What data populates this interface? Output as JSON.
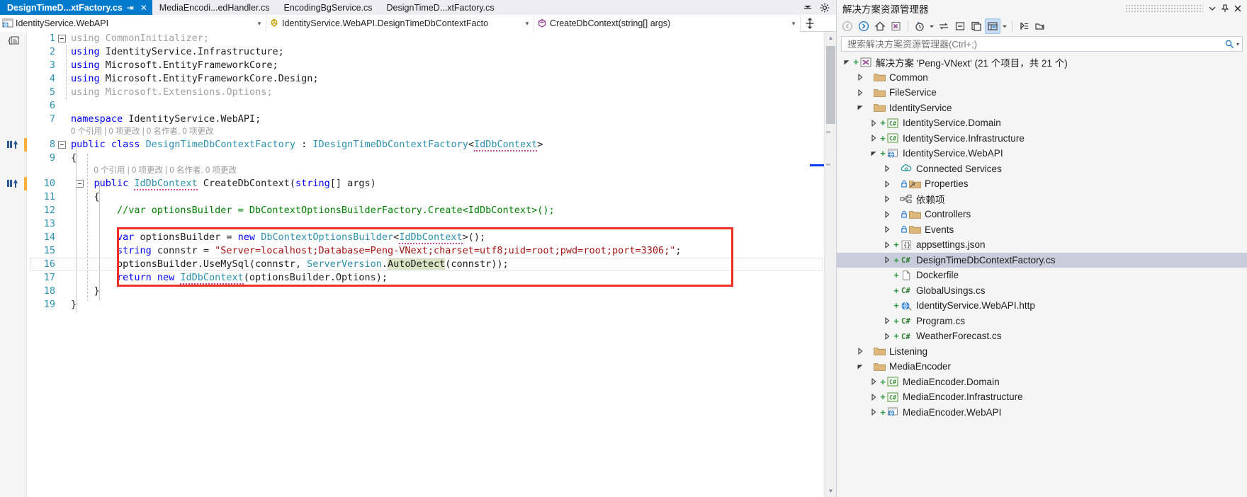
{
  "window": {
    "app": "Visual Studio",
    "accent_color": "#007acc",
    "highlight_box_color": "#ee3124"
  },
  "tabs": {
    "items": [
      {
        "label": "DesignTimeD...xtFactory.cs",
        "active": true,
        "pin_icon": "pin-icon",
        "close_icon": "close-icon"
      },
      {
        "label": "MediaEncodi...edHandler.cs",
        "active": false
      },
      {
        "label": "EncodingBgService.cs",
        "active": false
      },
      {
        "label": "DesignTimeD...xtFactory.cs",
        "active": false
      }
    ],
    "overflow_icon": "chevron-down-icon",
    "settings_icon": "gear-icon"
  },
  "navbar": {
    "project": {
      "text": "IdentityService.WebAPI",
      "icon": "web-project-icon",
      "arrow": "chevron-down-icon"
    },
    "type": {
      "text": "IdentityService.WebAPI.DesignTimeDbContextFacto",
      "icon": "class-icon",
      "arrow": "chevron-down-icon"
    },
    "member": {
      "text": "CreateDbContext(string[] args)",
      "icon": "method-icon",
      "arrow": "chevron-down-icon"
    },
    "split_icon": "split-window-icon"
  },
  "editor": {
    "lines": [
      {
        "num": "1",
        "indent": 0,
        "tokens": [
          {
            "t": "using CommonInitializer;",
            "c": "gray"
          }
        ],
        "collapse": true,
        "changed": false
      },
      {
        "num": "2",
        "indent": 0,
        "tokens": [
          {
            "t": "using",
            "c": "k"
          },
          {
            "t": " IdentityService.Infrastructure;",
            "c": "p"
          }
        ],
        "changed": false
      },
      {
        "num": "3",
        "indent": 0,
        "tokens": [
          {
            "t": "using",
            "c": "k"
          },
          {
            "t": " Microsoft.EntityFrameworkCore;",
            "c": "p"
          }
        ],
        "changed": false
      },
      {
        "num": "4",
        "indent": 0,
        "tokens": [
          {
            "t": "using",
            "c": "k"
          },
          {
            "t": " Microsoft.EntityFrameworkCore.Design;",
            "c": "p"
          }
        ],
        "changed": false
      },
      {
        "num": "5",
        "indent": 0,
        "tokens": [
          {
            "t": "using Microsoft.Extensions.Options;",
            "c": "gray"
          }
        ],
        "changed": false
      },
      {
        "num": "6",
        "indent": 0,
        "tokens": [
          {
            "t": "",
            "c": "p"
          }
        ],
        "changed": false
      },
      {
        "num": "7",
        "indent": 0,
        "tokens": [
          {
            "t": "namespace",
            "c": "k"
          },
          {
            "t": " IdentityService.WebAPI;",
            "c": "p"
          }
        ],
        "changed": false
      },
      {
        "num": "8",
        "indent": 0,
        "collapse": true,
        "changed": true,
        "tokens": [
          {
            "t": "public class ",
            "c": "k"
          },
          {
            "t": "DesignTimeDbContextFactory",
            "c": "t"
          },
          {
            "t": " : ",
            "c": "p"
          },
          {
            "t": "IDesignTimeDbContextFactory",
            "c": "t"
          },
          {
            "t": "<",
            "c": "p"
          },
          {
            "t": "IdDbContext",
            "c": "t und"
          },
          {
            "t": ">",
            "c": "p"
          }
        ]
      },
      {
        "num": "9",
        "indent": 0,
        "tokens": [
          {
            "t": "{",
            "c": "p"
          }
        ],
        "changed": false
      },
      {
        "num": "10",
        "indent": 1,
        "collapse": true,
        "changed": true,
        "tokens": [
          {
            "t": "public ",
            "c": "k"
          },
          {
            "t": "IdDbContext",
            "c": "t und"
          },
          {
            "t": " CreateDbContext(",
            "c": "p"
          },
          {
            "t": "string",
            "c": "k"
          },
          {
            "t": "[] args)",
            "c": "p"
          }
        ]
      },
      {
        "num": "11",
        "indent": 1,
        "tokens": [
          {
            "t": "{",
            "c": "p"
          }
        ],
        "changed": false
      },
      {
        "num": "12",
        "indent": 2,
        "tokens": [
          {
            "t": "//var optionsBuilder = DbContextOptionsBuilderFactory.Create<IdDbContext>();",
            "c": "c"
          }
        ],
        "changed": false
      },
      {
        "num": "13",
        "indent": 2,
        "tokens": [
          {
            "t": "",
            "c": "p"
          }
        ],
        "changed": false
      },
      {
        "num": "14",
        "indent": 2,
        "inbox": true,
        "tokens": [
          {
            "t": "var",
            "c": "k"
          },
          {
            "t": " optionsBuilder = ",
            "c": "p"
          },
          {
            "t": "new",
            "c": "k"
          },
          {
            "t": " ",
            "c": "p"
          },
          {
            "t": "DbContextOptionsBuilder",
            "c": "t"
          },
          {
            "t": "<",
            "c": "p"
          },
          {
            "t": "IdDbContext",
            "c": "t und"
          },
          {
            "t": ">();",
            "c": "p"
          }
        ]
      },
      {
        "num": "15",
        "indent": 2,
        "inbox": true,
        "tokens": [
          {
            "t": "string",
            "c": "k"
          },
          {
            "t": " connstr = ",
            "c": "p"
          },
          {
            "t": "\"Server=localhost;Database=Peng-VNext;charset=utf8;uid=root;pwd=root;port=3306;\"",
            "c": "s"
          },
          {
            "t": ";",
            "c": "p"
          }
        ]
      },
      {
        "num": "16",
        "indent": 2,
        "inbox": true,
        "current": true,
        "tokens": [
          {
            "t": "optionsBuilder.UseMySql(connstr, ",
            "c": "p"
          },
          {
            "t": "ServerVersion",
            "c": "t"
          },
          {
            "t": ".",
            "c": "p"
          },
          {
            "t": "AutoDetect",
            "c": "p hl"
          },
          {
            "t": "(connstr));",
            "c": "p"
          }
        ]
      },
      {
        "num": "17",
        "indent": 2,
        "inbox": true,
        "tokens": [
          {
            "t": "return new",
            "c": "k"
          },
          {
            "t": " ",
            "c": "p"
          },
          {
            "t": "IdDbContext",
            "c": "t und"
          },
          {
            "t": "(optionsBuilder.Options);",
            "c": "p"
          }
        ]
      },
      {
        "num": "18",
        "indent": 1,
        "tokens": [
          {
            "t": "}",
            "c": "p"
          }
        ],
        "changed": false
      },
      {
        "num": "19",
        "indent": 0,
        "tokens": [
          {
            "t": "}",
            "c": "p"
          }
        ],
        "changed": false
      }
    ],
    "codelens_class": "0 个引用 | 0 项更改 | 0 名作者, 0 项更改",
    "codelens_method": "0 个引用 | 0 项更改 | 0 名作者, 0 项更改",
    "structure_icon": "code-structure-icon"
  },
  "solution_explorer": {
    "title": "解决方案资源管理器",
    "header_buttons": [
      {
        "name": "minimize-icon",
        "glyph": "▾"
      },
      {
        "name": "pin-icon",
        "glyph": "⇩"
      },
      {
        "name": "close-icon",
        "glyph": "✕"
      }
    ],
    "toolbar": [
      {
        "name": "back-icon"
      },
      {
        "name": "forward-icon"
      },
      {
        "name": "home-icon"
      },
      {
        "name": "solution-icon"
      },
      {
        "name": "pending-changes-icon"
      },
      {
        "name": "pending-changes-dropdown-icon"
      },
      {
        "name": "sync-with-active-document-icon"
      },
      {
        "name": "collapse-all-icon"
      },
      {
        "name": "properties-window-icon"
      },
      {
        "name": "show-all-files-icon"
      },
      {
        "name": "show-all-files-dropdown-icon"
      },
      {
        "name": "preview-selected-items-icon"
      },
      {
        "name": "new-folder-icon"
      }
    ],
    "search_placeholder": "搜索解决方案资源管理器(Ctrl+;)",
    "search_icon": "search-icon",
    "search_dropdown_icon": "chevron-down-icon",
    "tree": [
      {
        "label": "解决方案 'Peng-VNext' (21 个项目，共 21 个)",
        "indent": 0,
        "twist": "expanded",
        "plus": true,
        "icon": "solution-icon"
      },
      {
        "label": "Common",
        "indent": 1,
        "twist": "collapsed",
        "plus": false,
        "icon": "folder-icon"
      },
      {
        "label": "FileService",
        "indent": 1,
        "twist": "collapsed",
        "plus": false,
        "icon": "folder-icon"
      },
      {
        "label": "IdentityService",
        "indent": 1,
        "twist": "expanded",
        "plus": false,
        "icon": "folder-icon"
      },
      {
        "label": "IdentityService.Domain",
        "indent": 2,
        "twist": "collapsed",
        "plus": true,
        "icon": "csharp-project-icon"
      },
      {
        "label": "IdentityService.Infrastructure",
        "indent": 2,
        "twist": "collapsed",
        "plus": true,
        "icon": "csharp-project-icon"
      },
      {
        "label": "IdentityService.WebAPI",
        "indent": 2,
        "twist": "expanded",
        "plus": true,
        "icon": "web-project-icon"
      },
      {
        "label": "Connected Services",
        "indent": 3,
        "twist": "collapsed",
        "plus": false,
        "icon": "connected-services-icon"
      },
      {
        "label": "Properties",
        "indent": 3,
        "twist": "collapsed",
        "plus": false,
        "lock": true,
        "icon": "properties-folder-icon"
      },
      {
        "label": "依赖项",
        "indent": 3,
        "twist": "collapsed",
        "plus": false,
        "icon": "dependencies-icon"
      },
      {
        "label": "Controllers",
        "indent": 3,
        "twist": "collapsed",
        "plus": false,
        "lock": true,
        "icon": "folder-icon"
      },
      {
        "label": "Events",
        "indent": 3,
        "twist": "collapsed",
        "plus": false,
        "lock": true,
        "icon": "folder-icon"
      },
      {
        "label": "appsettings.json",
        "indent": 3,
        "twist": "collapsed",
        "plus": true,
        "icon": "json-file-icon"
      },
      {
        "label": "DesignTimeDbContextFactory.cs",
        "indent": 3,
        "twist": "collapsed",
        "plus": true,
        "icon": "csharp-file-icon",
        "selected": true
      },
      {
        "label": "Dockerfile",
        "indent": 3,
        "twist": "none",
        "plus": true,
        "icon": "file-icon"
      },
      {
        "label": "GlobalUsings.cs",
        "indent": 3,
        "twist": "none",
        "plus": true,
        "icon": "csharp-file-icon"
      },
      {
        "label": "IdentityService.WebAPI.http",
        "indent": 3,
        "twist": "none",
        "plus": true,
        "icon": "http-file-icon"
      },
      {
        "label": "Program.cs",
        "indent": 3,
        "twist": "collapsed",
        "plus": true,
        "icon": "csharp-file-icon"
      },
      {
        "label": "WeatherForecast.cs",
        "indent": 3,
        "twist": "collapsed",
        "plus": true,
        "icon": "csharp-file-icon"
      },
      {
        "label": "Listening",
        "indent": 1,
        "twist": "collapsed",
        "plus": false,
        "icon": "folder-icon"
      },
      {
        "label": "MediaEncoder",
        "indent": 1,
        "twist": "expanded",
        "plus": false,
        "icon": "folder-icon"
      },
      {
        "label": "MediaEncoder.Domain",
        "indent": 2,
        "twist": "collapsed",
        "plus": true,
        "icon": "csharp-project-icon"
      },
      {
        "label": "MediaEncoder.Infrastructure",
        "indent": 2,
        "twist": "collapsed",
        "plus": true,
        "icon": "csharp-project-icon"
      },
      {
        "label": "MediaEncoder.WebAPI",
        "indent": 2,
        "twist": "collapsed",
        "plus": true,
        "icon": "web-project-icon"
      }
    ]
  }
}
